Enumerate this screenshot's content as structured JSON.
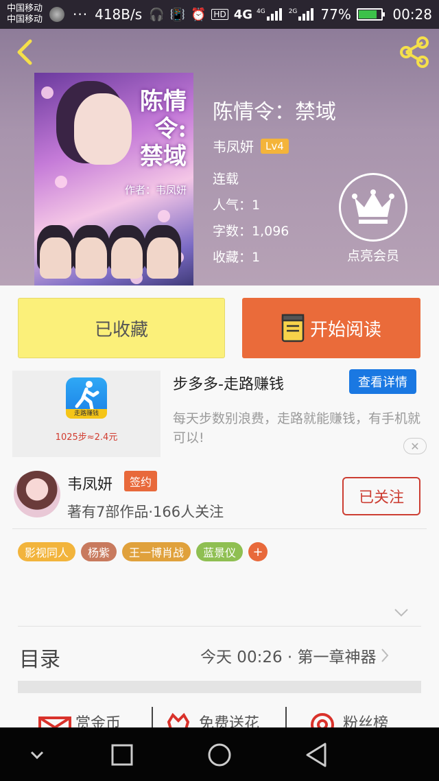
{
  "status_bar": {
    "carrier_1": "中国移动",
    "carrier_2": "中国移动",
    "dots": "···",
    "speed": "418B/s",
    "hd": "HD",
    "net_4g": "4G",
    "net_4g_small": "4G",
    "net_2g": "2G",
    "battery": "77%",
    "battery_level": 0.77,
    "time": "00:28"
  },
  "header": {
    "cover": {
      "title_line1": "陈情",
      "title_line2": "令:",
      "title_line3": "禁域",
      "author": "作者：韦凤妍"
    },
    "book_title": "陈情令：禁域",
    "author": "韦凤妍",
    "level": "Lv4",
    "status": "连载",
    "popularity": "人气：1",
    "word_count": "字数：1,096",
    "favorites": "收藏：1",
    "vip_label": "点亮会员"
  },
  "actions": {
    "collected": "已收藏",
    "start_reading": "开始阅读"
  },
  "ad": {
    "app_tag": "走路赚钱",
    "image_caption": "1025步≈2.4元",
    "title": "步多多-走路赚钱",
    "detail_button": "查看详情",
    "description": "每天步数别浪费，走路就能赚钱，有手机就可以!",
    "close": "✕"
  },
  "author_card": {
    "name": "韦凤妍",
    "badge": "签约",
    "stats": "著有7部作品·166人关注",
    "follow_button": "已关注"
  },
  "tags": [
    {
      "label": "影视同人",
      "color": "#f2b43c"
    },
    {
      "label": "杨紫",
      "color": "#c87a5e"
    },
    {
      "label": "王一博肖战",
      "color": "#e0a13c"
    },
    {
      "label": "蓝景仪",
      "color": "#8fbf52"
    }
  ],
  "tag_add": "+",
  "toc": {
    "title": "目录",
    "latest": "今天 00:26 · 第一章神器"
  },
  "bottom_actions": {
    "reward": "赏金币",
    "flowers": "免费送花",
    "fans": "粉丝榜"
  }
}
